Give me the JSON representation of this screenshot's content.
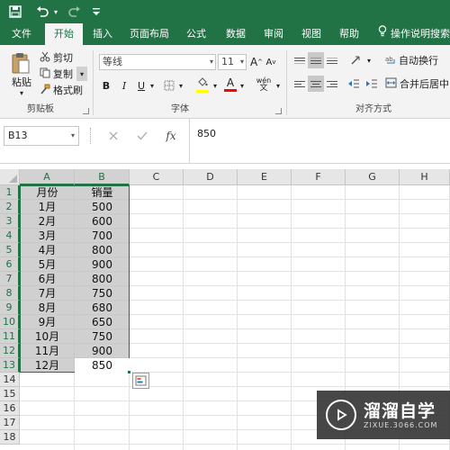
{
  "titlebar": {
    "icons": [
      "save-icon",
      "undo-icon",
      "undo-dropdown-icon",
      "redo-icon",
      "customize-quick-access-icon"
    ]
  },
  "tabs": [
    {
      "label": "文件"
    },
    {
      "label": "开始"
    },
    {
      "label": "插入"
    },
    {
      "label": "页面布局"
    },
    {
      "label": "公式"
    },
    {
      "label": "数据"
    },
    {
      "label": "审阅"
    },
    {
      "label": "视图"
    },
    {
      "label": "帮助"
    },
    {
      "label": "操作说明搜索"
    }
  ],
  "ribbon": {
    "clipboard": {
      "paste": "粘贴",
      "cut": "剪切",
      "copy": "复制",
      "format_painter": "格式刷",
      "group_label": "剪贴板"
    },
    "font": {
      "font_name": "等线",
      "font_size": "11",
      "bold": "B",
      "italic": "I",
      "underline": "U",
      "grow": "A",
      "shrink": "A",
      "font_color_letter": "A",
      "phonetic": "wén",
      "highlight_color": "#ffff00",
      "font_color": "#ff0000",
      "group_label": "字体"
    },
    "alignment": {
      "wrap_text": "自动换行",
      "merge_center": "合并后居中",
      "group_label": "对齐方式"
    }
  },
  "formula_bar": {
    "name_box": "B13",
    "fx_label": "fx",
    "value": "850"
  },
  "sheet": {
    "columns": [
      "A",
      "B",
      "C",
      "D",
      "E",
      "F",
      "G",
      "H"
    ],
    "rows": [
      "1",
      "2",
      "3",
      "4",
      "5",
      "6",
      "7",
      "8",
      "9",
      "10",
      "11",
      "12",
      "13",
      "14",
      "15",
      "16",
      "17",
      "18"
    ],
    "data": [
      [
        "月份",
        "销量"
      ],
      [
        "1月",
        "500"
      ],
      [
        "2月",
        "600"
      ],
      [
        "3月",
        "700"
      ],
      [
        "4月",
        "800"
      ],
      [
        "5月",
        "900"
      ],
      [
        "6月",
        "800"
      ],
      [
        "7月",
        "750"
      ],
      [
        "8月",
        "680"
      ],
      [
        "9月",
        "650"
      ],
      [
        "10月",
        "750"
      ],
      [
        "11月",
        "900"
      ],
      [
        "12月",
        "850"
      ]
    ]
  },
  "watermark": {
    "title": "溜溜自学",
    "url": "ZIXUE.3066.COM"
  },
  "colors": {
    "accent": "#217346",
    "selection_fill": "#bebebe"
  }
}
